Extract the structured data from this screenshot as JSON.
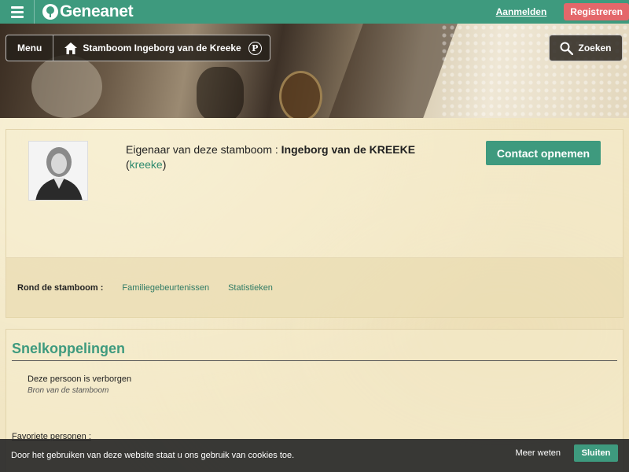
{
  "topbar": {
    "logo_text": "Geneanet",
    "login_label": "Aanmelden",
    "register_label": "Registreren"
  },
  "banner": {
    "menu_label": "Menu",
    "tree_label": "Stamboom Ingeborg van de Kreeke",
    "badge_letter": "P",
    "search_label": "Zoeken"
  },
  "owner": {
    "prefix": "Eigenaar van deze stamboom : ",
    "name": "Ingeborg van de KREEKE",
    "paren_open": "(",
    "username": "kreeke",
    "paren_close": ")",
    "contact_label": "Contact opnemen"
  },
  "around": {
    "label": "Rond de stamboom :",
    "links": [
      "Familiegebeurtenissen",
      "Statistieken"
    ]
  },
  "quick": {
    "title": "Snelkoppelingen",
    "hidden_person": "Deze persoon is verborgen",
    "source": "Bron van de stamboom",
    "favorites_label": "Favoriete personen :"
  },
  "cookie": {
    "message": "Door het gebruiken van deze website staat u ons gebruik van cookies toe.",
    "more_label": "Meer weten",
    "close_label": "Sluiten"
  },
  "colors": {
    "brand_green": "#3e9a7e",
    "register_red": "#e4676a",
    "link_green": "#2e8a6e"
  }
}
